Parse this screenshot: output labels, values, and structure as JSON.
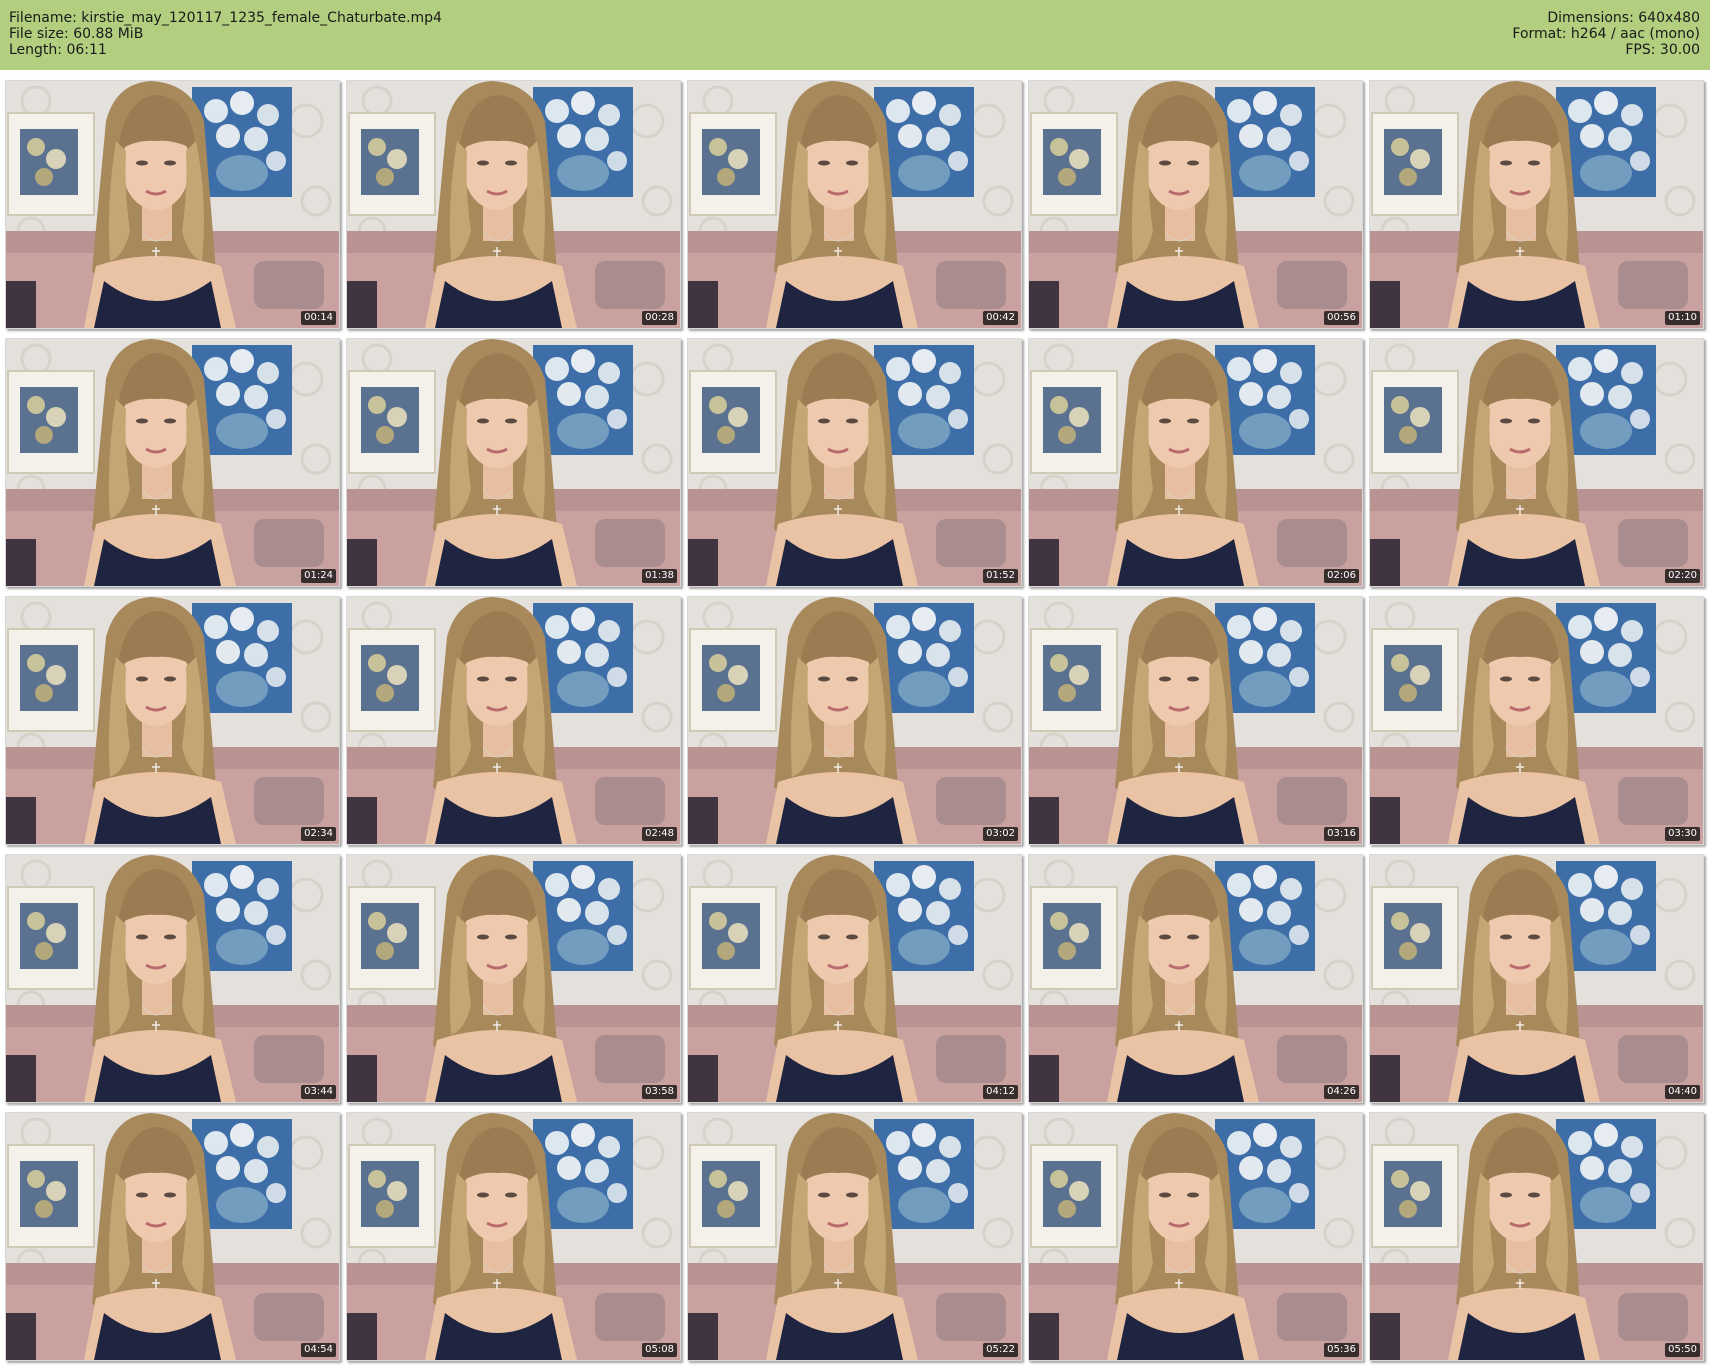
{
  "header": {
    "filename": "Filename: kirstie_may_120117_1235_female_Chaturbate.mp4",
    "filesize": "File size: 60.88 MiB",
    "length": "Length: 06:11",
    "dimensions": "Dimensions: 640x480",
    "format": "Format: h264 / aac (mono)",
    "fps": "FPS: 30.00"
  },
  "colors": {
    "header_bg": "#b2cf7f",
    "timestamp_bg": "#000000"
  },
  "thumbnails": [
    {
      "time": "00:14"
    },
    {
      "time": "00:28"
    },
    {
      "time": "00:42"
    },
    {
      "time": "00:56"
    },
    {
      "time": "01:10"
    },
    {
      "time": "01:24"
    },
    {
      "time": "01:38"
    },
    {
      "time": "01:52"
    },
    {
      "time": "02:06"
    },
    {
      "time": "02:20"
    },
    {
      "time": "02:34"
    },
    {
      "time": "02:48"
    },
    {
      "time": "03:02"
    },
    {
      "time": "03:16"
    },
    {
      "time": "03:30"
    },
    {
      "time": "03:44"
    },
    {
      "time": "03:58"
    },
    {
      "time": "04:12"
    },
    {
      "time": "04:26"
    },
    {
      "time": "04:40"
    },
    {
      "time": "04:54"
    },
    {
      "time": "05:08"
    },
    {
      "time": "05:22"
    },
    {
      "time": "05:36"
    },
    {
      "time": "05:50"
    }
  ]
}
